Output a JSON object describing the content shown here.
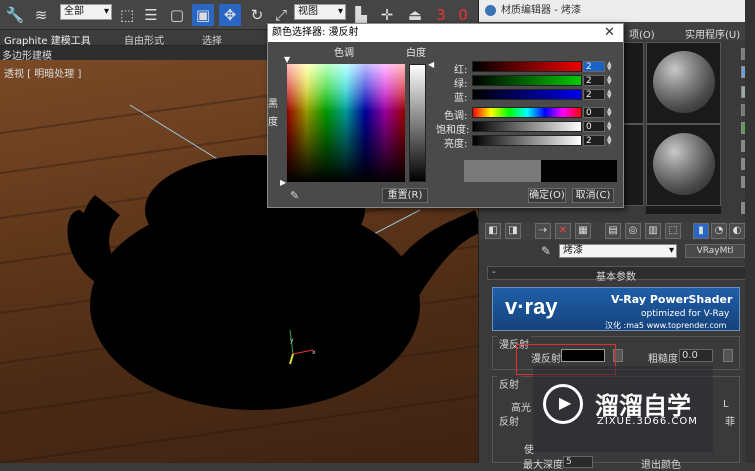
{
  "toolbar": {
    "select_filter": "全部",
    "view_select": "视图",
    "icons": [
      "wrench-icon",
      "helix-icon",
      "select-arrow-icon",
      "list-icon",
      "rect-select-icon",
      "window-cross-icon",
      "move-icon",
      "rotate-icon",
      "scale-icon",
      "snap-icon",
      "mirror-icon",
      "number-3-icon",
      "number-0-icon"
    ]
  },
  "ribbon": {
    "tabs": [
      "Graphite 建模工具",
      "自由形式",
      "选择"
    ],
    "subtab": "多边形建模"
  },
  "viewport": {
    "label_view": "透视",
    "label_shading": "明暗处理"
  },
  "material_editor": {
    "title": "材质编辑器 - 烤漆",
    "menu_items": [
      "项(O)",
      "实用程序(U)"
    ],
    "material_name": "烤漆",
    "material_type": "VRayMtl",
    "rollout_title": "基本参数",
    "vray_logo": "v·ray",
    "vray_product": "V-Ray PowerShader",
    "vray_subtitle": "optimized for V-Ray",
    "vray_credit": "汉化 :ma5 www.toprender.com",
    "diffuse_group": "漫反射",
    "diffuse_label": "漫反射",
    "roughness_label": "粗糙度",
    "roughness_value": "0.0",
    "reflect_group": "反射",
    "highlight_label": "高光",
    "reflect_label": "反射",
    "use_label": "使",
    "max_depth_label": "最大深度",
    "exit_color_label": "退出颜色",
    "max_depth_value": "5",
    "highlight_extra": "L",
    "reflect_extra": "菲",
    "diffuse_color": "#000000"
  },
  "color_dialog": {
    "title": "颜色选择器: 漫反射",
    "hue_header": "色调",
    "white_header": "白度",
    "black_label": "黑度",
    "labels": {
      "red": "红:",
      "green": "绿:",
      "blue": "蓝:",
      "hue": "色调:",
      "saturation": "饱和度:",
      "value": "亮度:"
    },
    "values": {
      "red": "2",
      "green": "2",
      "blue": "2",
      "hue": "0",
      "saturation": "0",
      "value": "2"
    },
    "reset_button": "重置(R)",
    "ok_button": "确定(O)",
    "cancel_button": "取消(C)",
    "old_color": "#7a7a7a",
    "new_color": "#020202"
  },
  "watermark": {
    "brand": "溜溜自学",
    "url": "ZIXUE.3D66.COM"
  }
}
